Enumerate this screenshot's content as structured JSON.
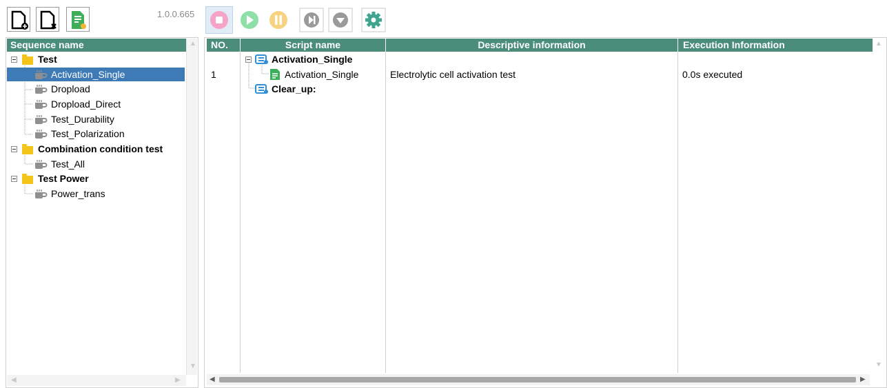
{
  "toolbar": {
    "new_icon": "new-file-icon",
    "delete_icon": "delete-file-icon",
    "report_icon": "report-icon",
    "version": "1.0.0.665",
    "buttons": [
      {
        "icon": "stop-icon",
        "color": "#f5a3c7"
      },
      {
        "icon": "play-icon",
        "color": "#8fe0a8"
      },
      {
        "icon": "pause-icon",
        "color": "#f7d27f"
      },
      {
        "icon": "next-step-icon",
        "color": "#a0a0a0"
      },
      {
        "icon": "dropdown-icon",
        "color": "#a0a0a0"
      },
      {
        "icon": "settings-icon",
        "color": "#3fa58f"
      }
    ]
  },
  "sequence_panel": {
    "header": "Sequence name",
    "groups": [
      {
        "label": "Test",
        "items": [
          "Activation_Single",
          "Dropload",
          "Dropload_Direct",
          "Test_Durability",
          "Test_Polarization"
        ]
      },
      {
        "label": "Combination condition test",
        "items": [
          "Test_All"
        ]
      },
      {
        "label": "Test Power",
        "items": [
          "Power_trans"
        ]
      }
    ],
    "selected": "Activation_Single"
  },
  "script_table": {
    "columns": [
      "NO.",
      "Script name",
      "Descriptive information",
      "Execution Information"
    ],
    "tree": {
      "group1": "Activation_Single",
      "child_no": "1",
      "child": "Activation_Single",
      "child_desc": "Electrolytic cell activation test",
      "child_exec": "0.0s executed",
      "group2": "Clear_up:"
    }
  },
  "colors": {
    "header_bg": "#4a8d7a",
    "selection_bg": "#3e7ab6"
  }
}
